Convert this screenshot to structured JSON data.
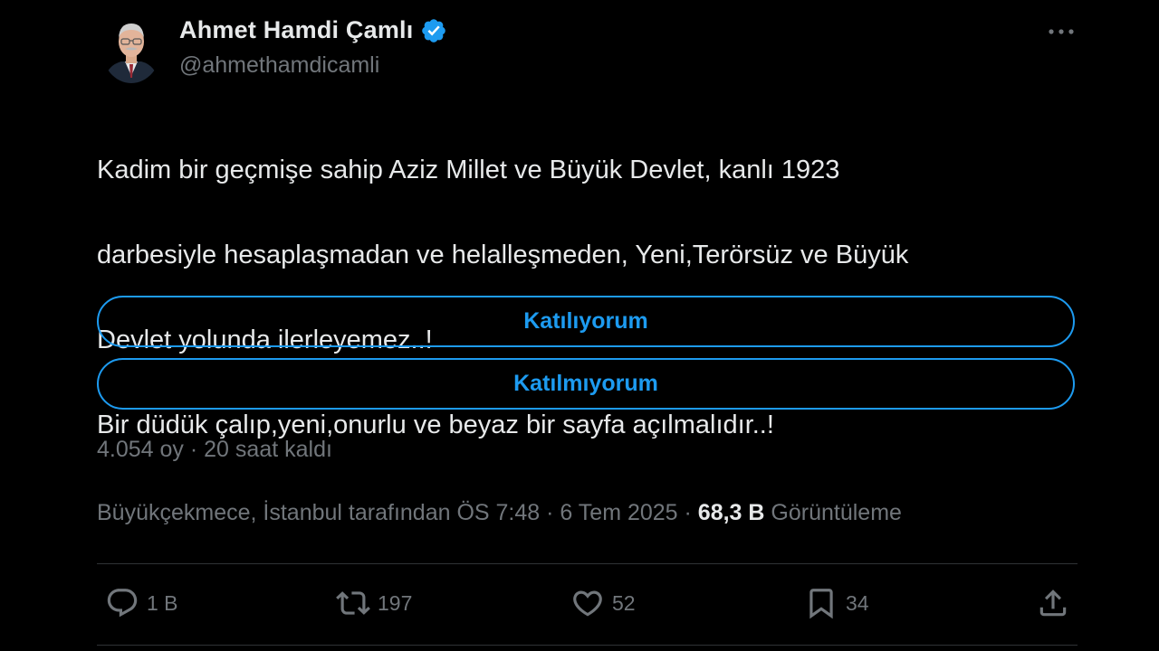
{
  "author": {
    "display_name": "Ahmet Hamdi Çamlı",
    "handle": "@ahmethamdicamli",
    "verified": true
  },
  "tweet": {
    "lines": [
      "Kadim bir geçmişe sahip Aziz Millet  ve Büyük Devlet, kanlı 1923",
      "darbesiyle hesaplaşmadan ve helalleşmeden, Yeni,Terörsüz ve Büyük",
      "Devlet yolunda ilerleyemez..!",
      "Bir düdük çalıp,yeni,onurlu ve beyaz bir sayfa açılmalıdır..!"
    ]
  },
  "poll": {
    "options": [
      {
        "label": "Katılıyorum"
      },
      {
        "label": "Katılmıyorum"
      }
    ],
    "votes": "4.054 oy",
    "separator": "·",
    "time_left": "20 saat kaldı"
  },
  "meta": {
    "location_prefix": "Büyükçekmece, İstanbul tarafından ÖS 7:48 · 6 Tem 2025 · ",
    "views_count": "68,3 B",
    "views_label": " Görüntüleme"
  },
  "actions": {
    "reply_count": "1 B",
    "retweet_count": "197",
    "like_count": "52",
    "bookmark_count": "34"
  },
  "colors": {
    "background": "#000000",
    "text": "#e7e9ea",
    "secondary": "#71767b",
    "accent": "#1d9bf0",
    "divider": "#2f3336"
  },
  "icons": {
    "verified": "verified-badge-icon",
    "more": "more-dots-icon",
    "reply": "reply-icon",
    "retweet": "retweet-icon",
    "like": "heart-icon",
    "bookmark": "bookmark-icon",
    "share": "share-icon"
  }
}
